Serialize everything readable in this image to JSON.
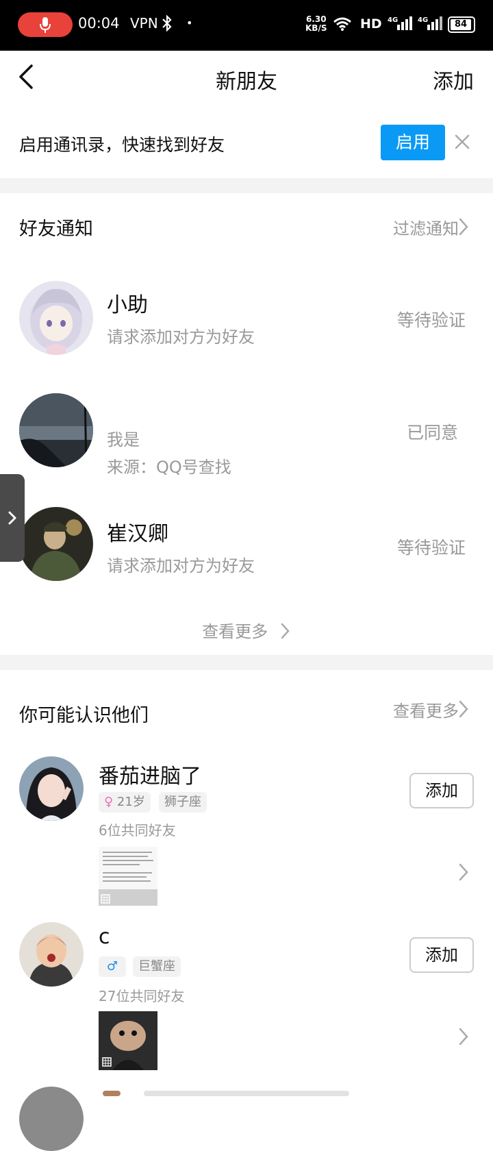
{
  "status_bar": {
    "time": "00:04",
    "vpn": "VPN",
    "net_speed_value": "6.30",
    "net_speed_unit": "KB/S",
    "hd": "HD",
    "battery": "84"
  },
  "header": {
    "title": "新朋友",
    "add_label": "添加"
  },
  "contacts_banner": {
    "text": "启用通讯录，快速找到好友",
    "enable_label": "启用"
  },
  "friend_notifications": {
    "title": "好友通知",
    "filter_label": "过滤通知",
    "items": [
      {
        "name": "小助",
        "line1": "请求添加对方为好友",
        "line2": "",
        "status": "等待验证"
      },
      {
        "name": "",
        "line1": "我是",
        "line2": "来源：QQ号查找",
        "status": "已同意"
      },
      {
        "name": "崔汉卿",
        "line1": "请求添加对方为好友",
        "line2": "",
        "status": "等待验证"
      }
    ],
    "view_more": "查看更多"
  },
  "suggestions": {
    "title": "你可能认识他们",
    "view_more": "查看更多",
    "items": [
      {
        "name": "番茄进脑了",
        "gender": "female",
        "age": "21岁",
        "zodiac": "狮子座",
        "mutual": "6位共同好友",
        "add_label": "添加"
      },
      {
        "name": "c",
        "gender": "male",
        "age": "",
        "zodiac": "巨蟹座",
        "mutual": "27位共同好友",
        "add_label": "添加"
      }
    ]
  },
  "colors": {
    "accent": "#0a9af5",
    "female": "#f06fb3",
    "male": "#1e8fe8",
    "mic_pill": "#e8423a"
  }
}
